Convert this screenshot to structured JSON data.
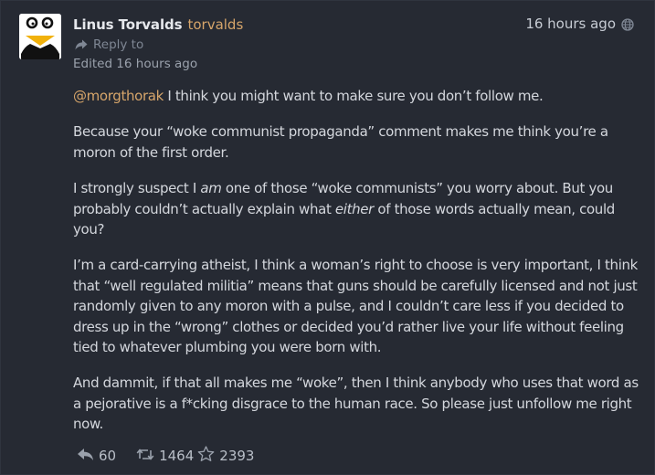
{
  "author": {
    "display_name": "Linus Torvalds",
    "username": "torvalds",
    "avatar": "tux-penguin-avatar"
  },
  "meta": {
    "reply_label": "Reply to",
    "edited_label": "Edited 16 hours ago",
    "timestamp": "16 hours ago",
    "visibility_icon": "globe-icon"
  },
  "post": {
    "p1": {
      "mention": "@morgthorak",
      "text": " I think you might want to make sure you don’t follow me."
    },
    "p2": "Because your “woke communist propaganda” comment makes me think you’re a moron of the first order.",
    "p3": {
      "a": "I strongly suspect I ",
      "em1": "am",
      "b": " one of those “woke communists” you worry about. But you probably couldn’t actually explain what ",
      "em2": "either",
      "c": " of those words actually mean, could you?"
    },
    "p4": "I’m a card-carrying atheist, I think a woman’s right to choose is very important, I think that “well regulated militia” means that guns should be carefully licensed and not just randomly given to any moron with a pulse, and I couldn’t care less if you decided to dress up in the “wrong” clothes or decided you’d rather live your life without feeling tied to whatever plumbing you were born with.",
    "p5": "And dammit, if that all makes me “woke”, then I think anybody who uses that word as a pejorative is a f*cking disgrace to the human race. So please just unfollow me right now."
  },
  "actions": {
    "replies": "60",
    "boosts": "1464",
    "favourites": "2393"
  },
  "colors": {
    "background": "#262a33",
    "accent": "#d6a56a",
    "text": "#d4d7dd",
    "muted": "#7f8794"
  }
}
